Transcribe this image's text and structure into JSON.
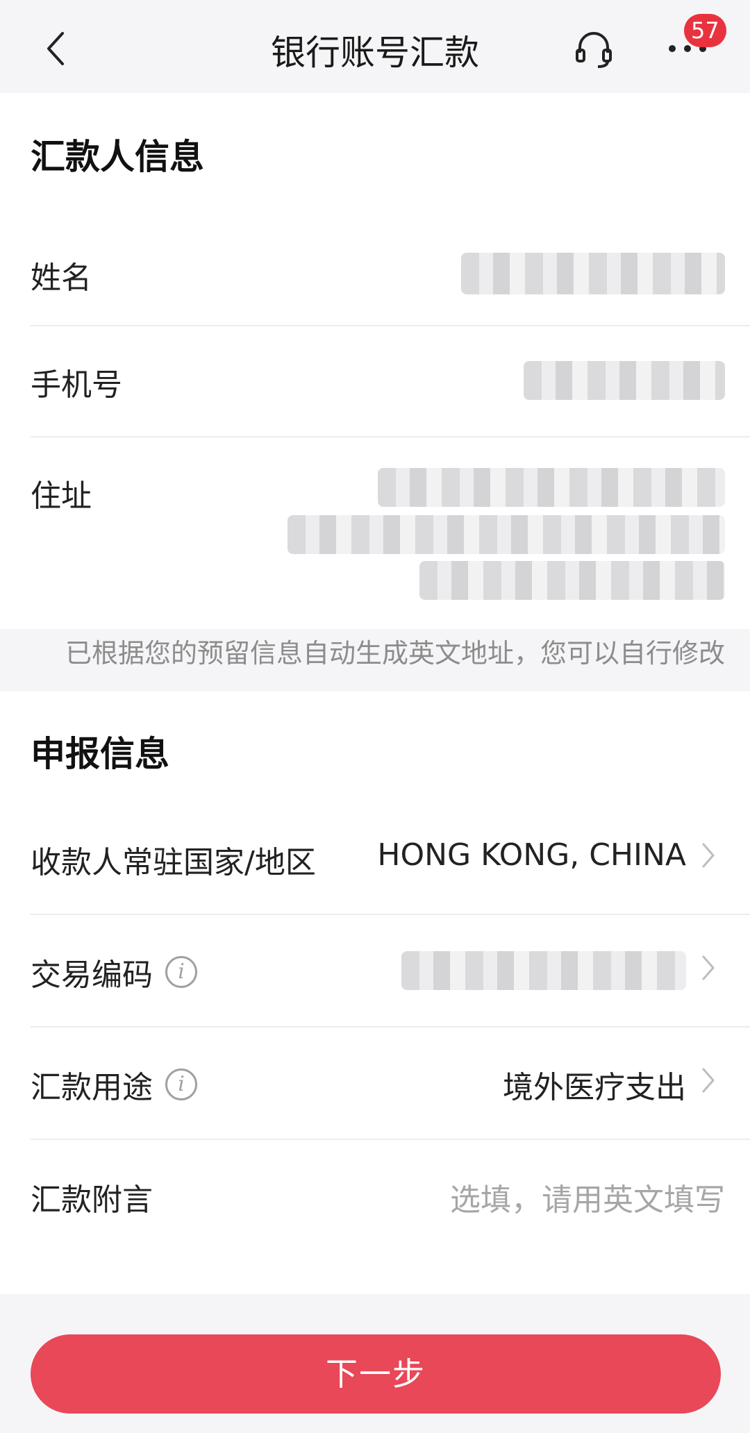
{
  "header": {
    "title": "银行账号汇款",
    "badge_count": "57"
  },
  "sender_section": {
    "title": "汇款人信息",
    "name_label": "姓名",
    "phone_label": "手机号",
    "address_label": "住址"
  },
  "hint_text": "已根据您的预留信息自动生成英文地址，您可以自行修改",
  "declaration_section": {
    "title": "申报信息",
    "country_label": "收款人常驻国家/地区",
    "country_value": "HONG KONG, CHINA",
    "trade_code_label": "交易编码",
    "purpose_label": "汇款用途",
    "purpose_value": "境外医疗支出",
    "remark_label": "汇款附言",
    "remark_placeholder": "选填，请用英文填写"
  },
  "footer": {
    "next_label": "下一步"
  },
  "colors": {
    "accent": "#e84858",
    "badge": "#e8333f"
  },
  "icons": {
    "back": "chevron-left",
    "customer_service": "headset",
    "more": "ellipsis",
    "info": "info-circle",
    "row_arrow": "chevron-right"
  }
}
